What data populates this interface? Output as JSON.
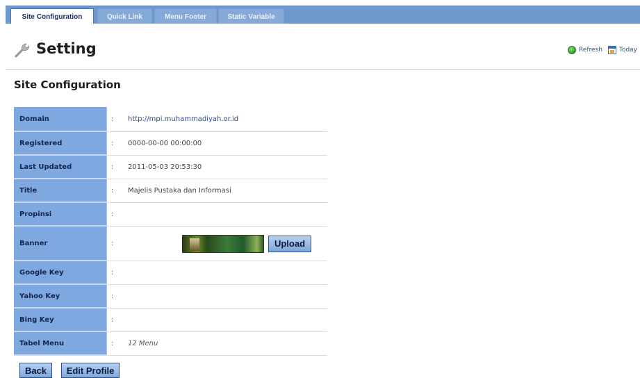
{
  "tabs": [
    {
      "label": "Site Configuration",
      "active": true
    },
    {
      "label": "Quick Link",
      "active": false
    },
    {
      "label": "Menu Footer",
      "active": false
    },
    {
      "label": "Static Variable",
      "active": false
    }
  ],
  "header": {
    "title": "Setting",
    "icon": "wrench-icon",
    "refresh_label": "Refresh",
    "today_label": "Today"
  },
  "section": {
    "title": "Site Configuration"
  },
  "fields": {
    "separator": ":",
    "domain": {
      "label": "Domain",
      "value": "http://mpi.muhammadiyah.or.id"
    },
    "registered": {
      "label": "Registered",
      "value": "0000-00-00 00:00:00"
    },
    "last_updated": {
      "label": "Last Updated",
      "value": "2011-05-03 20:53:30"
    },
    "title": {
      "label": "Title",
      "value": "Majelis Pustaka dan Informasi"
    },
    "propinsi": {
      "label": "Propinsi",
      "value": ""
    },
    "banner": {
      "label": "Banner",
      "upload_label": "Upload"
    },
    "google_key": {
      "label": "Google Key",
      "value": ""
    },
    "yahoo_key": {
      "label": "Yahoo Key",
      "value": ""
    },
    "bing_key": {
      "label": "Bing Key",
      "value": ""
    },
    "tabel_menu": {
      "label": "Tabel Menu",
      "value": "12 Menu"
    }
  },
  "actions": {
    "back_label": "Back",
    "edit_profile_label": "Edit Profile"
  },
  "colors": {
    "tab_bar": "#6f98cc",
    "label_cell": "#7fa7e0",
    "link": "#1f4f9a"
  }
}
